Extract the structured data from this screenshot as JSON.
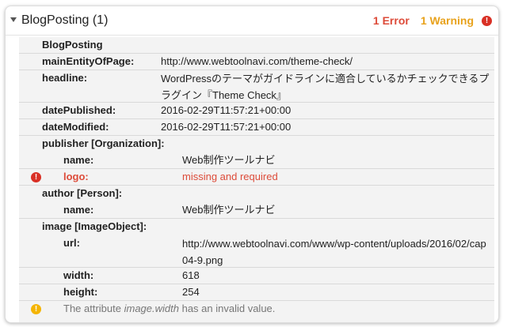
{
  "item": {
    "title": "BlogPosting (1)",
    "error_count_label": "1 Error",
    "warning_count_label": "1 Warning",
    "icons": {
      "error": "error-exclamation-icon",
      "warning": "warning-exclamation-icon"
    },
    "colors": {
      "error": "#dd4b39",
      "warning": "#e8a21c",
      "error_icon": "#d93025",
      "warning_icon": "#f4b400"
    }
  },
  "type_label": "BlogPosting",
  "rows": {
    "main_entity": {
      "key": "mainEntityOfPage:",
      "value": "http://www.webtoolnavi.com/theme-check/"
    },
    "headline": {
      "key": "headline:",
      "value": "WordPressのテーマがガイドラインに適合しているかチェックできるプラグイン『Theme Check』"
    },
    "date_published": {
      "key": "datePublished:",
      "value": "2016-02-29T11:57:21+00:00"
    },
    "date_modified": {
      "key": "dateModified:",
      "value": "2016-02-29T11:57:21+00:00"
    },
    "publisher": {
      "key": "publisher [Organization]:",
      "name": {
        "key": "name:",
        "value": "Web制作ツールナビ"
      },
      "logo": {
        "key": "logo:",
        "value": "missing and required"
      }
    },
    "author": {
      "key": "author [Person]:",
      "name": {
        "key": "name:",
        "value": "Web制作ツールナビ"
      }
    },
    "image": {
      "key": "image [ImageObject]:",
      "url": {
        "key": "url:",
        "value": "http://www.webtoolnavi.com/www/wp-content/uploads/2016/02/cap04-9.png"
      },
      "width": {
        "key": "width:",
        "value": "618"
      },
      "height": {
        "key": "height:",
        "value": "254"
      }
    }
  },
  "warning": {
    "prefix": "The attribute ",
    "attribute": "image.width",
    "suffix": " has an invalid value."
  }
}
